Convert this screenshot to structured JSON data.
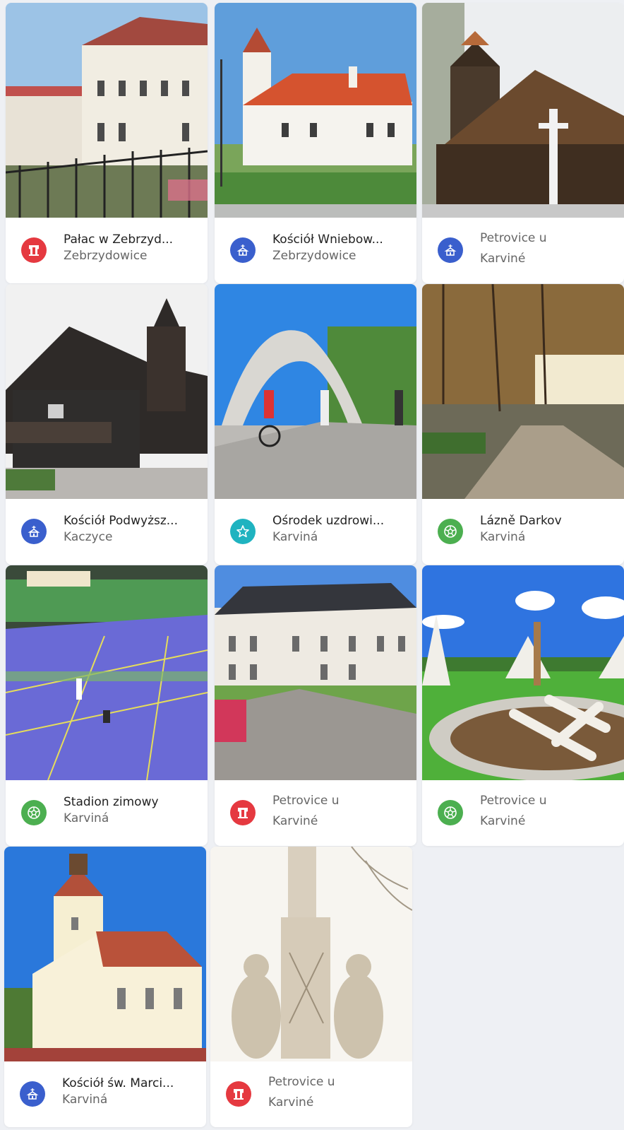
{
  "colors": {
    "heritage": "#e53940",
    "church": "#3a5fcd",
    "spa": "#1fb3c0",
    "sport": "#4caf50"
  },
  "cards": [
    {
      "title": "Pałac w Zebrzyd...",
      "subtitle": "Zebrzydowice",
      "icon": "heritage-icon"
    },
    {
      "title": "Kościół Wniebow...",
      "subtitle": "Zebrzydowice",
      "icon": "church-icon"
    },
    {
      "title": "Petrovice u",
      "subtitle": "Karviné",
      "icon": "church-icon"
    },
    {
      "title": "Kościół Podwyższ...",
      "subtitle": "Kaczyce",
      "icon": "church-icon"
    },
    {
      "title": "Ośrodek uzdrowi...",
      "subtitle": "Karviná",
      "icon": "spa-icon"
    },
    {
      "title": "Lázně Darkov",
      "subtitle": "Karviná",
      "icon": "sport-icon"
    },
    {
      "title": "Stadion zimowy",
      "subtitle": "Karviná",
      "icon": "sport-icon"
    },
    {
      "title": "Petrovice u",
      "subtitle": "Karviné",
      "icon": "heritage-icon"
    },
    {
      "title": "Petrovice u",
      "subtitle": "Karviné",
      "icon": "sport-icon"
    },
    {
      "title": "Kościół św. Marci...",
      "subtitle": "Karviná",
      "icon": "church-icon"
    },
    {
      "title": "Petrovice u",
      "subtitle": "Karviné",
      "icon": "heritage-icon"
    }
  ]
}
